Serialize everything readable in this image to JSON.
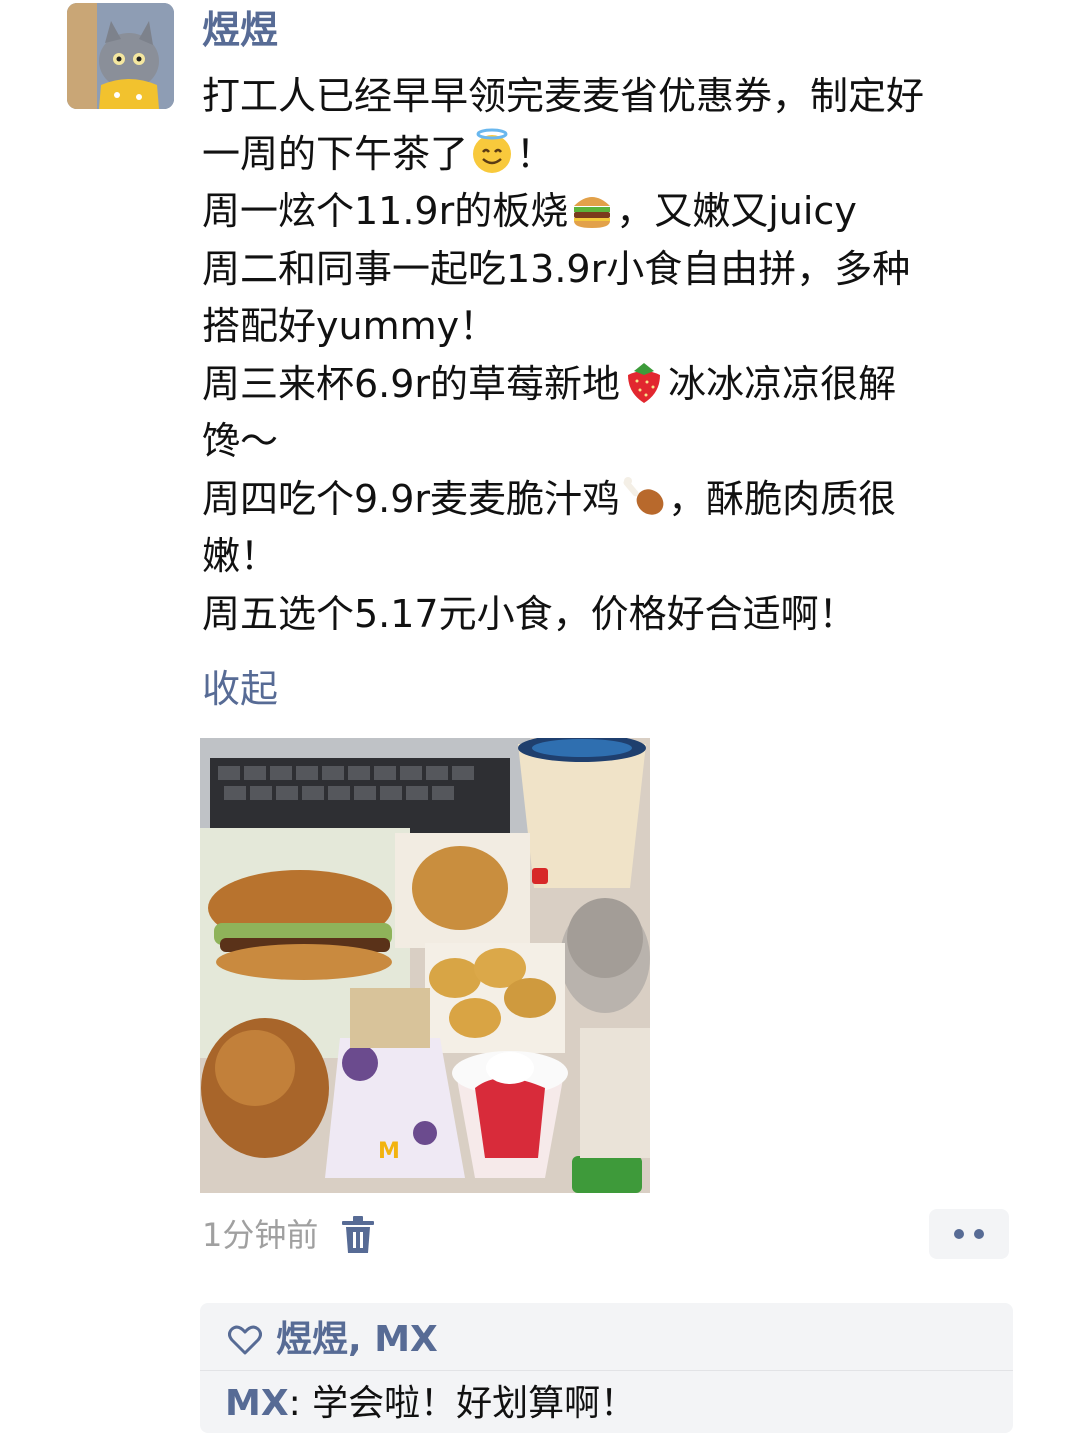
{
  "post": {
    "username": "煜煜",
    "lines": [
      {
        "text": "打工人已经早早领完麦麦省优惠券，制定好"
      },
      {
        "text": "一周的下午茶了",
        "emoji": "halo-smile-icon",
        "tail": "！"
      },
      {
        "text": "周一炫个11.9r的板烧",
        "emoji": "burger-icon",
        "tail": "，又嫩又juicy"
      },
      {
        "text": "周二和同事一起吃13.9r小食自由拼，多种"
      },
      {
        "text": "搭配好yummy！"
      },
      {
        "text": "周三来杯6.9r的草莓新地",
        "emoji": "strawberry-icon",
        "tail": "冰冰凉凉很解"
      },
      {
        "text": "馋～"
      },
      {
        "text": "周四吃个9.9r麦麦脆汁鸡",
        "emoji": "drumstick-icon",
        "tail": "，酥脆肉质很"
      },
      {
        "text": "嫩！"
      },
      {
        "text": "周五选个5.17元小食，价格好合适啊！"
      }
    ],
    "collapse_label": "收起",
    "photo": {
      "icon": "food-photo"
    },
    "time": "1分钟前"
  },
  "interactions": {
    "likes": "煜煜, MX",
    "comments": [
      {
        "author": "MX",
        "separator": ": ",
        "text": "学会啦！好划算啊！"
      }
    ]
  },
  "colors": {
    "link": "#576b95",
    "text": "#111111",
    "muted": "#a0a0a0",
    "panel": "#f3f4f6"
  }
}
